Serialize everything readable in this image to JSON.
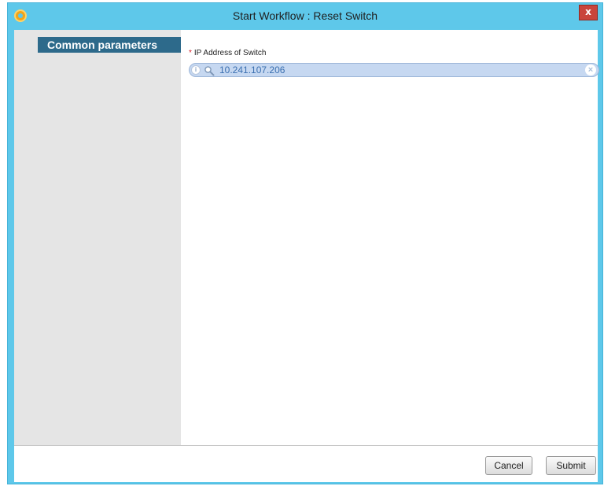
{
  "window": {
    "title": "Start Workflow : Reset Switch",
    "close_label": "x"
  },
  "sidebar": {
    "items": [
      {
        "label": "Common parameters"
      }
    ]
  },
  "form": {
    "ip_field": {
      "required_marker": "*",
      "label": "IP Address of Switch",
      "value": "10.241.107.206",
      "info_glyph": "i",
      "clear_glyph": "×"
    }
  },
  "footer": {
    "cancel_label": "Cancel",
    "submit_label": "Submit"
  },
  "icons": {
    "app": "workflow-app-icon",
    "close": "close-icon",
    "info": "info-icon",
    "search": "search-icon",
    "clear": "clear-icon"
  },
  "colors": {
    "titlebar": "#5ec8ea",
    "sidebar": "#e5e5e5",
    "nav_item_active": "#2d6a8b",
    "field_bg": "#c6d8f1",
    "required": "#d4202a",
    "close_button": "#c9453b"
  }
}
